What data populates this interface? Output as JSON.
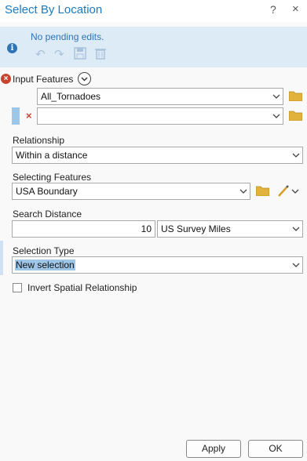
{
  "title": "Select By Location",
  "titlebar": {
    "help": "?",
    "close": "×"
  },
  "banner": {
    "message": "No pending edits."
  },
  "input_features": {
    "label": "Input Features",
    "value1": "All_Tornadoes",
    "value2": ""
  },
  "relationship": {
    "label": "Relationship",
    "value": "Within a distance"
  },
  "selecting_features": {
    "label": "Selecting Features",
    "value": "USA Boundary"
  },
  "search_distance": {
    "label": "Search Distance",
    "value": "10",
    "unit": "US Survey Miles"
  },
  "selection_type": {
    "label": "Selection Type",
    "value": "New selection"
  },
  "invert": {
    "label": "Invert Spatial Relationship",
    "checked": false
  },
  "buttons": {
    "apply": "Apply",
    "ok": "OK"
  },
  "colors": {
    "accent": "#1a7ac5",
    "banner_bg": "#ddebf7",
    "error": "#c7452e"
  }
}
